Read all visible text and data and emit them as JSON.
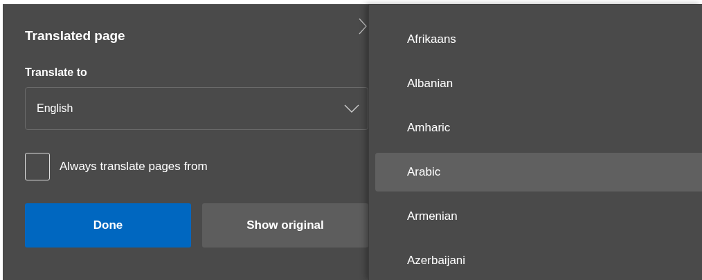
{
  "panel": {
    "title": "Translated page",
    "translate_to_label": "Translate to",
    "language_select": {
      "value": "English"
    },
    "always_translate": {
      "label": "Always translate pages from",
      "checked": false
    },
    "buttons": [
      {
        "label": "Done",
        "kind": "primary"
      },
      {
        "label": "Show original",
        "kind": "secondary"
      }
    ]
  },
  "language_menu": {
    "items": [
      {
        "label": "Afrikaans",
        "selected": false
      },
      {
        "label": "Albanian",
        "selected": false
      },
      {
        "label": "Amharic",
        "selected": false
      },
      {
        "label": "Arabic",
        "selected": true
      },
      {
        "label": "Armenian",
        "selected": false
      },
      {
        "label": "Azerbaijani",
        "selected": false
      }
    ]
  }
}
